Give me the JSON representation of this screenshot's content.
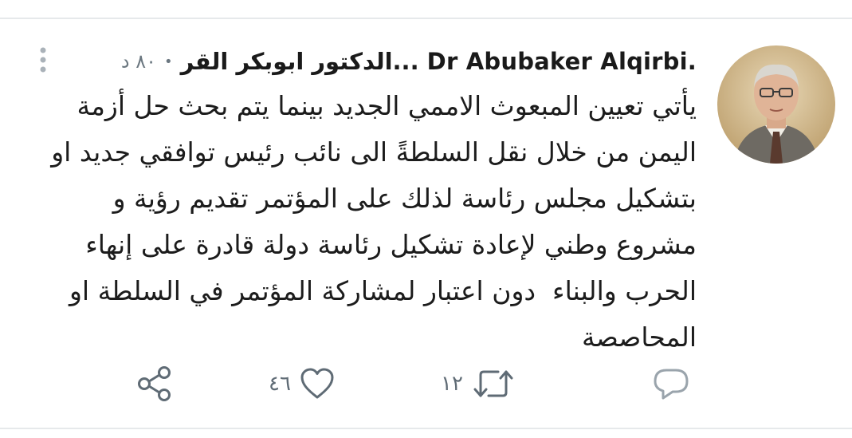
{
  "tweet": {
    "display_name": "الدكتور ابوبكر القر... Dr Abubaker Alqirbi.",
    "time_ago": "٨٠ د",
    "text": "يأتي تعيين المبعوث الاممي الجديد بينما يتم بحث حل أزمة اليمن من خلال نقل السلطةً الى نائب رئيس توافقي جديد او بتشكيل مجلس رئاسة لذلك على المؤتمر تقديم رؤية و مشروع وطني لإعادة تشكيل رئاسة دولة قادرة على إنهاء الحرب والبناء  دون اعتبار لمشاركة المؤتمر في السلطة او المحاصصة"
  },
  "actions": {
    "reply": {
      "icon": "reply-icon",
      "count": ""
    },
    "retweet": {
      "icon": "retweet-icon",
      "count": "١٢"
    },
    "like": {
      "icon": "heart-icon",
      "count": "٤٦"
    },
    "share": {
      "icon": "share-icon",
      "count": ""
    }
  },
  "header": {
    "more_icon": "more-vertical-icon"
  },
  "colors": {
    "text": "#1c1c1c",
    "secondary": "#6b7780",
    "divider": "#e6e9eb"
  }
}
